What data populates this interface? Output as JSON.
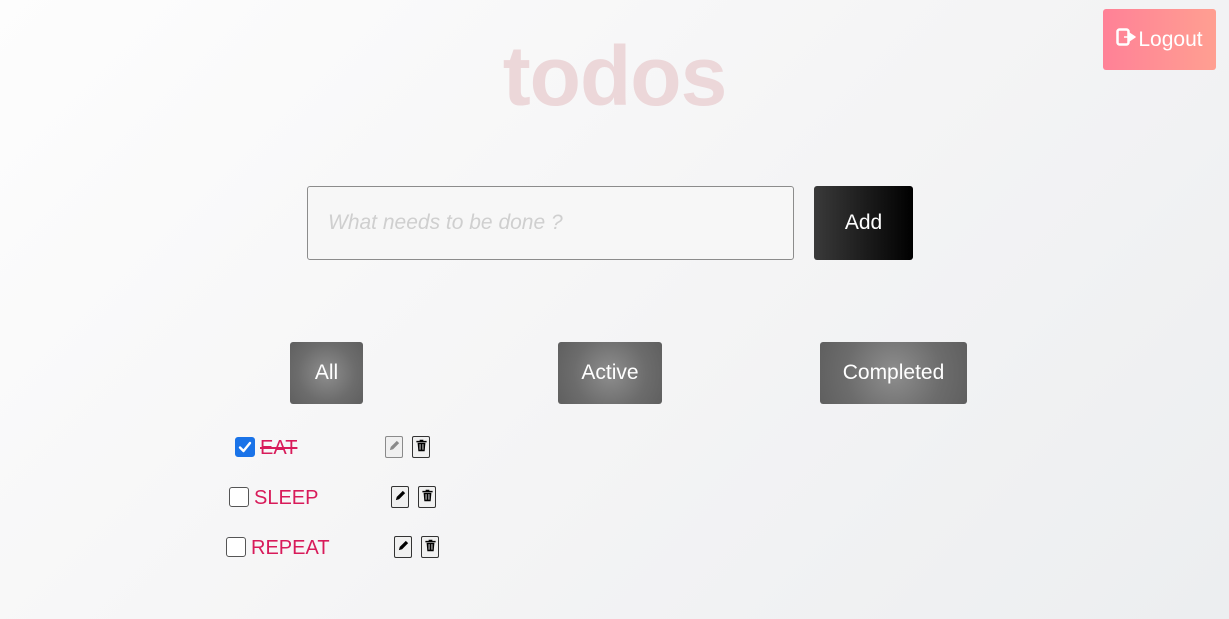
{
  "header": {
    "logout_label": "Logout",
    "logout_icon": "sign-out-icon",
    "title": "todos"
  },
  "new_todo": {
    "placeholder": "What needs to be done ?",
    "value": "",
    "add_label": "Add"
  },
  "filters": [
    {
      "label": "All"
    },
    {
      "label": "Active"
    },
    {
      "label": "Completed"
    }
  ],
  "todos": [
    {
      "text": "EAT",
      "completed": true
    },
    {
      "text": "SLEEP",
      "completed": false
    },
    {
      "text": "REPEAT",
      "completed": false
    }
  ],
  "colors": {
    "accent": "#ff8a95",
    "todo_text": "#d81b5a",
    "title": "#ecd7d9",
    "checkbox_checked": "#1a73e8"
  }
}
